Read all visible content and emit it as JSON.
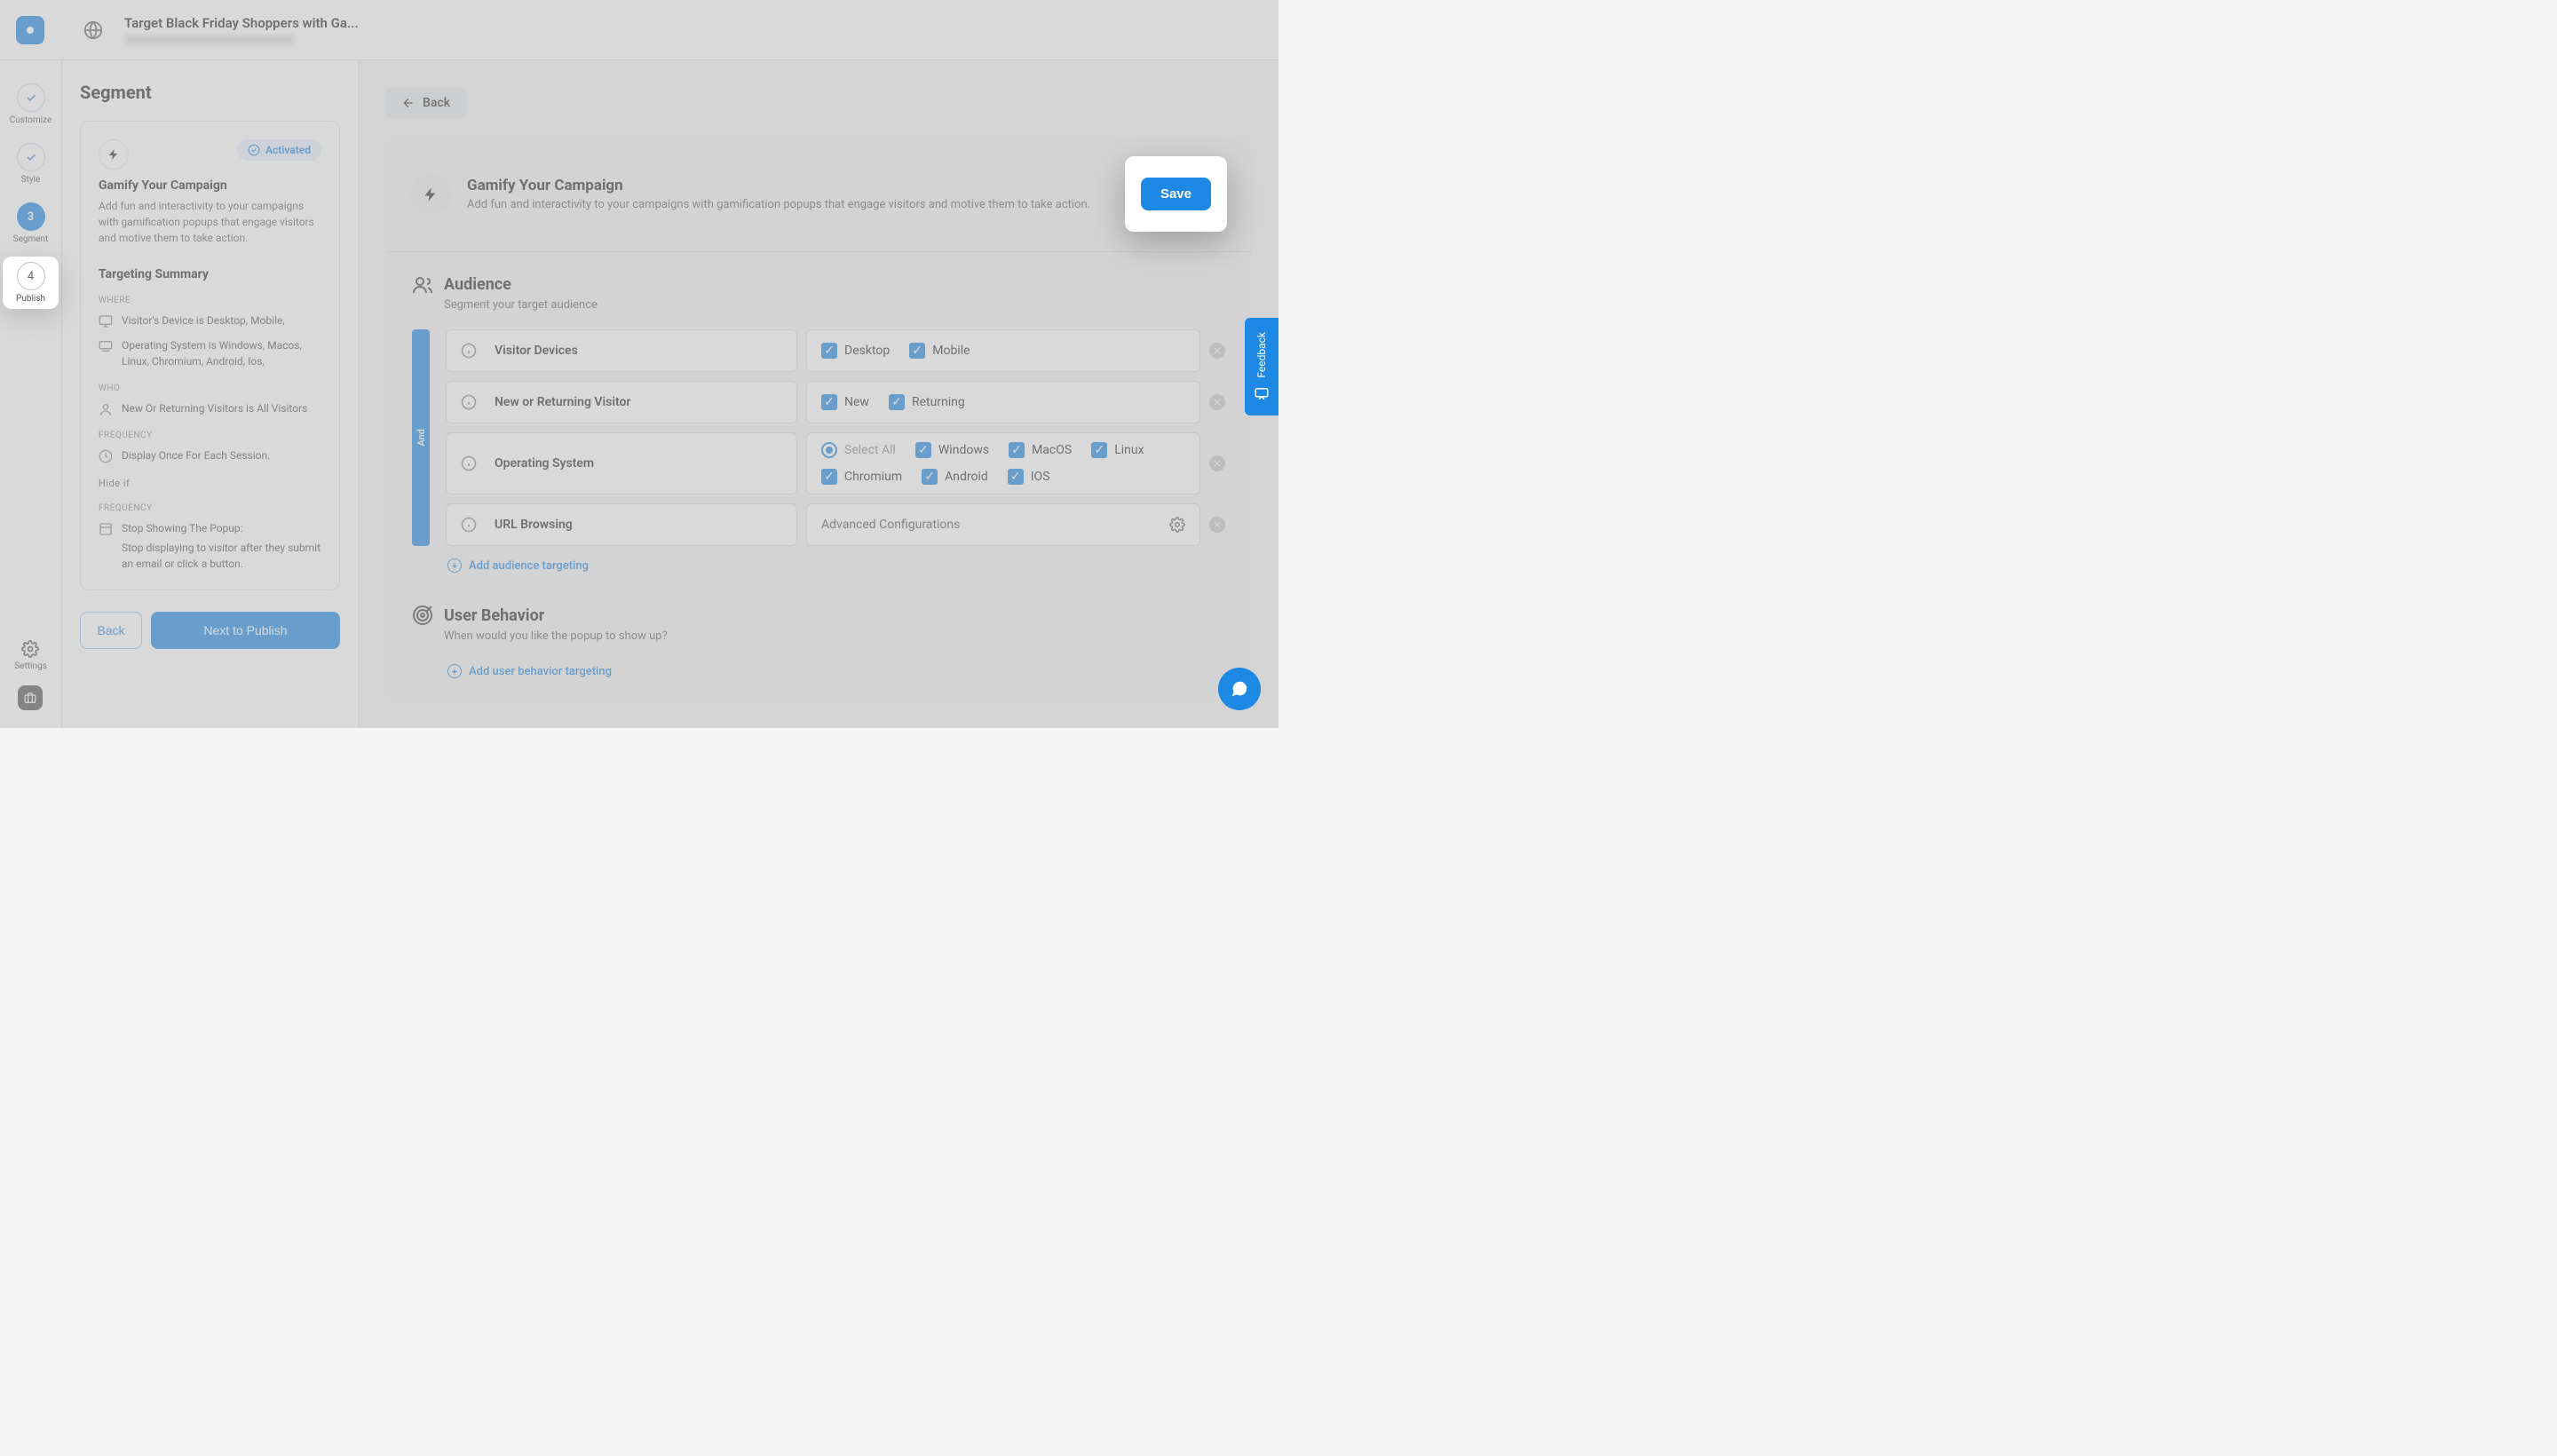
{
  "header": {
    "title": "Target Black Friday Shoppers with Ga..."
  },
  "steps": [
    {
      "label": "Customize",
      "state": "done"
    },
    {
      "label": "Style",
      "state": "done"
    },
    {
      "num": "3",
      "label": "Segment",
      "state": "active"
    },
    {
      "num": "4",
      "label": "Publish",
      "state": "pending"
    }
  ],
  "settings_label": "Settings",
  "sidebar": {
    "heading": "Segment",
    "activated": "Activated",
    "card_title": "Gamify Your Campaign",
    "card_desc": "Add fun and interactivity to your campaigns with gamification popups that engage visitors and motive them to take action.",
    "ts_heading": "Targeting Summary",
    "where": "WHERE",
    "where_items": [
      "Visitor's Device is Desktop, Mobile,",
      "Operating System is Windows, Macos, Linux, Chromium, Android, Ios,"
    ],
    "who": "WHO",
    "who_items": [
      "New Or Returning Visitors is All Visitors"
    ],
    "frequency": "FREQUENCY",
    "freq_items": [
      "Display Once For Each Session."
    ],
    "hideif": "Hide if",
    "hide_label": "FREQUENCY",
    "hide_title": "Stop Showing The Popup:",
    "hide_desc": "Stop displaying to visitor after they submit an email or click a button.",
    "back": "Back",
    "next": "Next to Publish"
  },
  "main": {
    "back": "Back",
    "banner_title": "Gamify Your Campaign",
    "banner_desc": "Add fun and interactivity to your campaigns with gamification popups that engage visitors and motive them to take action.",
    "save": "Save",
    "audience": {
      "title": "Audience",
      "sub": "Segment your target audience",
      "and": "And",
      "rows": [
        {
          "label": "Visitor Devices",
          "opts": [
            "Desktop",
            "Mobile"
          ]
        },
        {
          "label": "New or Returning Visitor",
          "opts": [
            "New",
            "Returning"
          ]
        },
        {
          "label": "Operating System",
          "select_all": "Select All",
          "opts": [
            "Windows",
            "MacOS",
            "Linux",
            "Chromium",
            "Android",
            "IOS"
          ]
        },
        {
          "label": "URL Browsing",
          "adv": "Advanced Configurations"
        }
      ],
      "add": "Add audience targeting"
    },
    "behavior": {
      "title": "User Behavior",
      "sub": "When would you like the popup to show up?",
      "add": "Add user behavior targeting"
    }
  },
  "feedback": "Feedback"
}
